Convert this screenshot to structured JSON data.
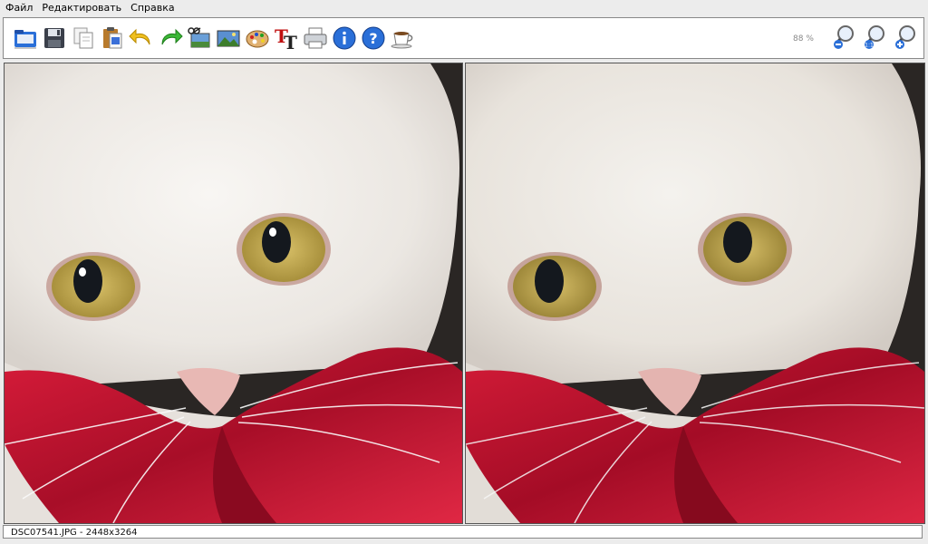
{
  "menu": {
    "items": [
      "Файл",
      "Редактировать",
      "Справка"
    ]
  },
  "toolbar": {
    "buttons": [
      "open-icon",
      "save-icon",
      "copy-icon",
      "paste-icon",
      "undo-icon",
      "redo-icon",
      "crop-icon",
      "image-icon",
      "palette-icon",
      "text-icon",
      "print-icon",
      "info-icon",
      "help-icon",
      "coffee-icon"
    ],
    "zoom_level": "88 %",
    "zoom_buttons": [
      "zoom-out-icon",
      "zoom-reset-icon",
      "zoom-in-icon"
    ]
  },
  "status": {
    "text": "DSC07541.JPG - 2448x3264"
  },
  "colors": {
    "accent_blue": "#1f5fbf",
    "bow_red": "#c01830",
    "cat_white": "#f2ede6",
    "eye_gold": "#c8a848"
  }
}
